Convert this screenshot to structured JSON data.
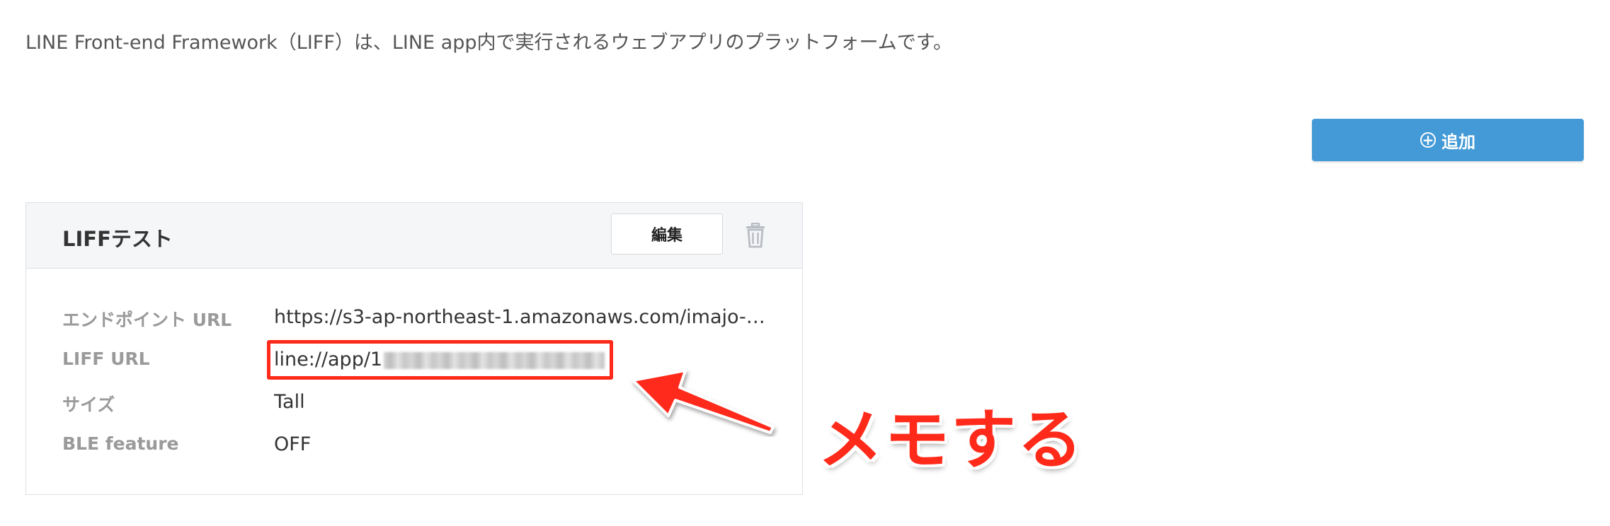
{
  "intro_text": "LINE Front-end Framework（LIFF）は、LINE app内で実行されるウェブアプリのプラットフォームです。",
  "toolbar": {
    "add_label": "追加"
  },
  "liff_app": {
    "title": "LIFFテスト",
    "edit_label": "編集",
    "details": [
      {
        "label": "エンドポイント URL",
        "value": "https://s3-ap-northeast-1.amazonaws.com/imajo-te…"
      },
      {
        "label": "LIFF URL",
        "value": "line://app/1"
      },
      {
        "label": "サイズ",
        "value": "Tall"
      },
      {
        "label": "BLE feature",
        "value": "OFF"
      }
    ]
  },
  "annotation": {
    "text": "メモする",
    "color": "#ff2a1a"
  },
  "colors": {
    "accent_button": "#439ad6",
    "annotation_red": "#ff2a1a"
  }
}
